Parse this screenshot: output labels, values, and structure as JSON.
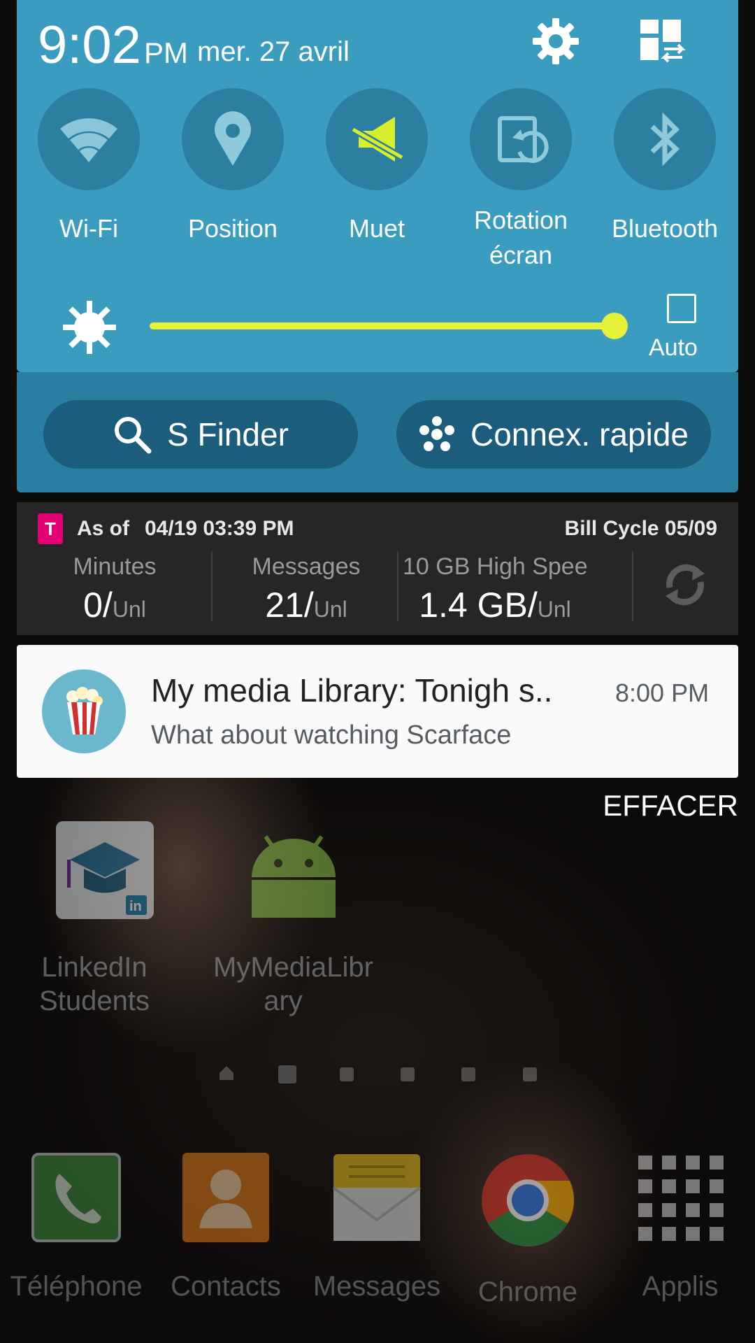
{
  "status": {
    "time": "9:02",
    "ampm": "PM",
    "date": "mer. 27 avril"
  },
  "quick_toggles": [
    {
      "label": "Wi-Fi",
      "icon": "wifi-icon",
      "active": false
    },
    {
      "label": "Position",
      "icon": "location-pin-icon",
      "active": false
    },
    {
      "label": "Muet",
      "icon": "mute-icon",
      "active": true
    },
    {
      "label_line1": "Rotation",
      "label_line2": "écran",
      "icon": "screen-rotation-icon",
      "active": false
    },
    {
      "label": "Bluetooth",
      "icon": "bluetooth-icon",
      "active": false
    }
  ],
  "brightness": {
    "level": 1.0,
    "auto_label": "Auto",
    "auto_checked": false
  },
  "buttons": {
    "finder": "S Finder",
    "quick_connect": "Connex. rapide"
  },
  "usage_widget": {
    "as_of_label": "As of",
    "as_of_value": "04/19 03:39 PM",
    "bill_cycle": "Bill Cycle 05/09",
    "columns": [
      {
        "label": "Minutes",
        "value": "0/",
        "unit": "Unl"
      },
      {
        "label": "Messages",
        "value": "21/",
        "unit": "Unl"
      },
      {
        "label": "10 GB High Spee…",
        "value": "1.4 GB/",
        "unit": "Unl"
      }
    ]
  },
  "notification": {
    "title": "My media Library: Tonigh s..",
    "time": "8:00 PM",
    "text": "What about watching Scarface"
  },
  "clear_label": "EFFACER",
  "home_apps": [
    {
      "line1": "LinkedIn",
      "line2": "Students",
      "icon": "linkedin-students-icon"
    },
    {
      "line1": "MyMediaLibr",
      "line2": "ary",
      "icon": "android-icon"
    }
  ],
  "dock_apps": [
    {
      "label": "Téléphone",
      "icon": "phone-icon"
    },
    {
      "label": "Contacts",
      "icon": "contacts-icon"
    },
    {
      "label": "Messages",
      "icon": "messages-icon"
    },
    {
      "label": "Chrome",
      "icon": "chrome-icon"
    },
    {
      "label": "Applis",
      "icon": "apps-grid-icon"
    }
  ],
  "colors": {
    "panel": "#3a9dbf",
    "panel_dark": "#2a7ea1",
    "accent": "#e6f23a",
    "tmobile": "#e20074"
  }
}
